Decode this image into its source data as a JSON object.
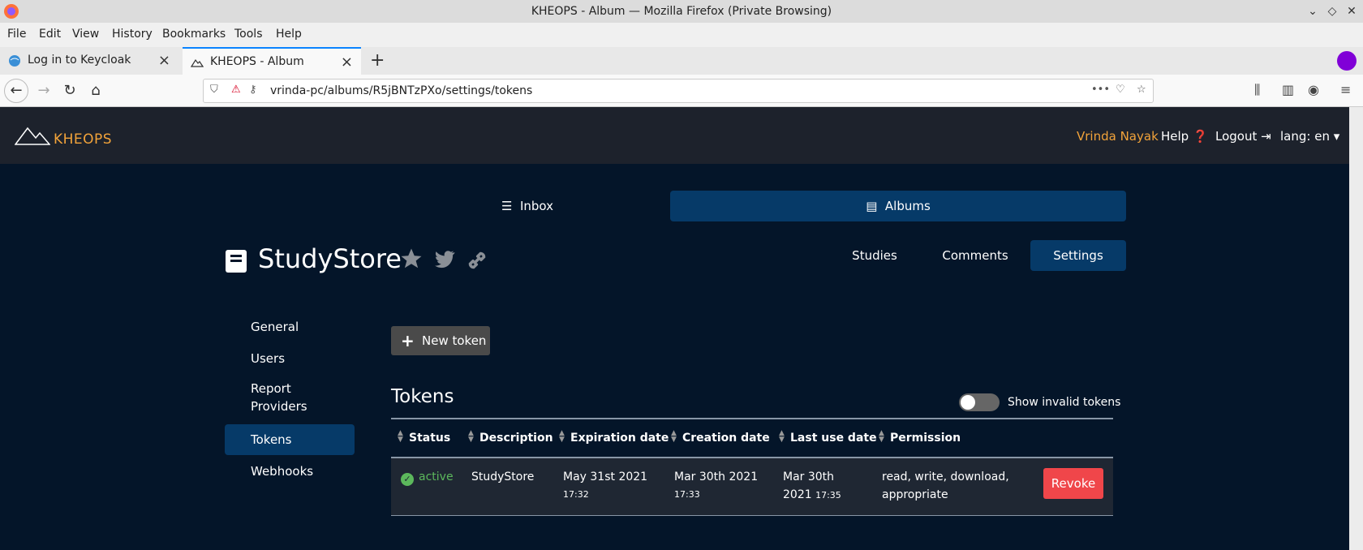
{
  "window": {
    "title": "KHEOPS - Album — Mozilla Firefox (Private Browsing)"
  },
  "menubar": {
    "items": [
      "File",
      "Edit",
      "View",
      "History",
      "Bookmarks",
      "Tools",
      "Help"
    ]
  },
  "tabs": [
    {
      "label": "Log in to Keycloak"
    },
    {
      "label": "KHEOPS - Album"
    }
  ],
  "navbar": {
    "url": "vrinda-pc/albums/R5jBNTzPXo/settings/tokens"
  },
  "app": {
    "logo": "KHEOPS",
    "user": "Vrinda Nayak",
    "help": "Help",
    "logout": "Logout",
    "lang": "lang: en"
  },
  "main_tabs": {
    "inbox": "Inbox",
    "albums": "Albums"
  },
  "album": {
    "title": "StudyStore"
  },
  "subtabs": {
    "studies": "Studies",
    "comments": "Comments",
    "settings": "Settings"
  },
  "sidebar": {
    "items": [
      {
        "label": "General"
      },
      {
        "label": "Users"
      },
      {
        "label": "Report Providers"
      },
      {
        "label": "Tokens"
      },
      {
        "label": "Webhooks"
      }
    ]
  },
  "tokens": {
    "new_token": "New token",
    "title": "Tokens",
    "show_invalid": "Show invalid tokens",
    "columns": [
      "Status",
      "Description",
      "Expiration date",
      "Creation date",
      "Last use date",
      "Permission"
    ],
    "rows": [
      {
        "status": "active",
        "description": "StudyStore",
        "expiration_date": "May 31st 2021",
        "expiration_time": "17:32",
        "creation_date": "Mar 30th 2021",
        "creation_time": "17:33",
        "last_use_date_1": "Mar 30th",
        "last_use_date_2": "2021",
        "last_use_time": "17:35",
        "permission": "read, write, download, appropriate",
        "action": "Revoke"
      }
    ]
  },
  "colors": {
    "accent": "#f2a33a",
    "active_bg": "#063a68",
    "revoke": "#f0464a",
    "status_active": "#5cb85c"
  }
}
